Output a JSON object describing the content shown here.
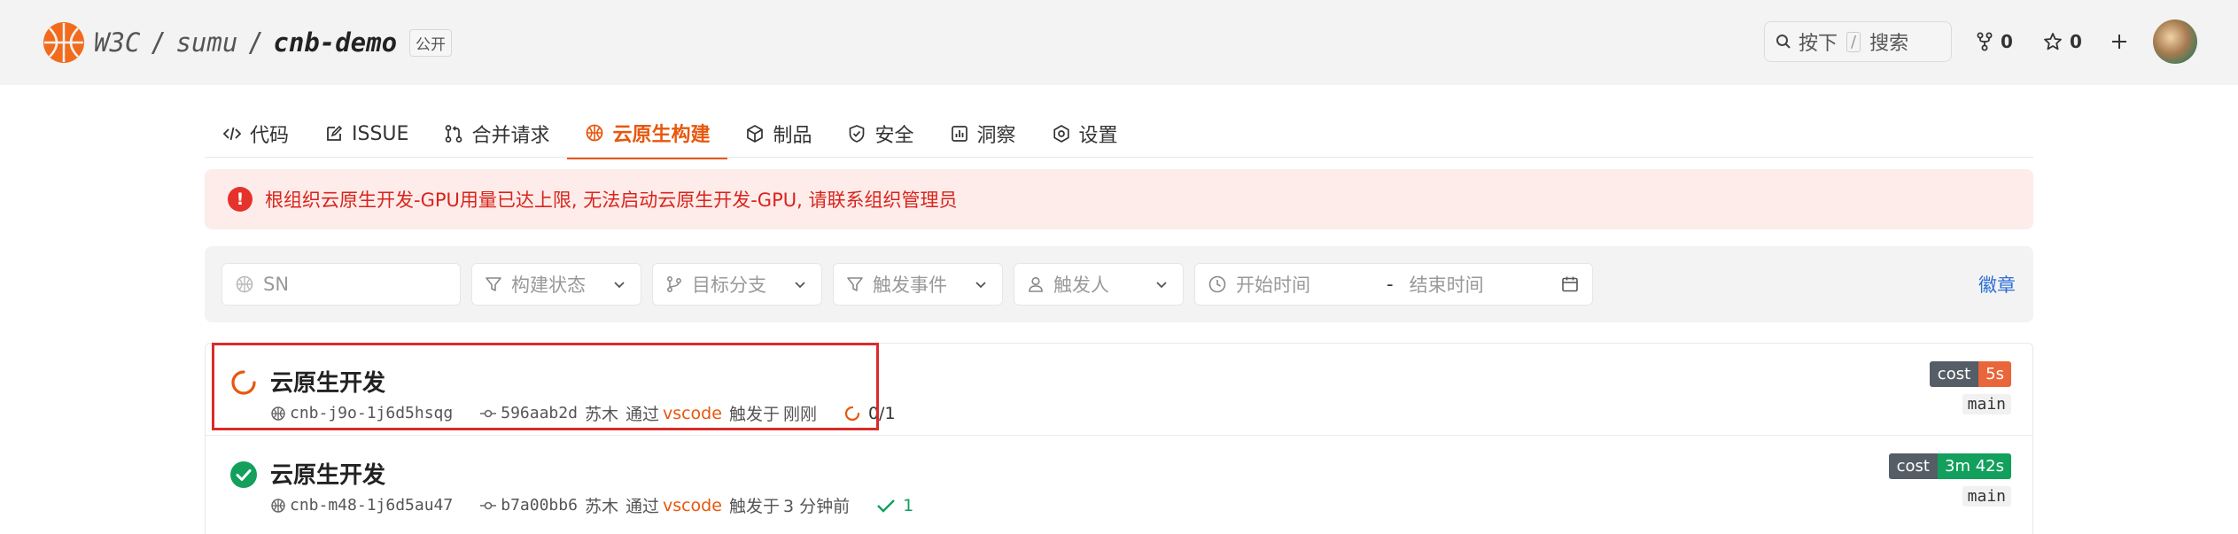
{
  "header": {
    "org": "W3C",
    "group": "sumu",
    "repo": "cnb-demo",
    "visibility": "公开",
    "search": {
      "press": "按下",
      "key": "/",
      "label": "搜索"
    },
    "forks": "0",
    "stars": "0"
  },
  "tabs": [
    {
      "label": "代码",
      "icon": "code-icon"
    },
    {
      "label": "ISSUE",
      "icon": "edit-icon"
    },
    {
      "label": "合并请求",
      "icon": "pull-request-icon"
    },
    {
      "label": "云原生构建",
      "icon": "build-icon",
      "active": true
    },
    {
      "label": "制品",
      "icon": "package-icon"
    },
    {
      "label": "安全",
      "icon": "shield-icon"
    },
    {
      "label": "洞察",
      "icon": "chart-icon"
    },
    {
      "label": "设置",
      "icon": "gear-icon"
    }
  ],
  "alert": {
    "text": "根组织云原生开发-GPU用量已达上限, 无法启动云原生开发-GPU, 请联系组织管理员"
  },
  "filters": {
    "sn_placeholder": "SN",
    "status": "构建状态",
    "branch": "目标分支",
    "event": "触发事件",
    "trigger_user": "触发人",
    "start_time": "开始时间",
    "range_sep": "-",
    "end_time": "结束时间",
    "badge_link": "徽章"
  },
  "builds": [
    {
      "title": "云原生开发",
      "status": "running",
      "sn": "cnb-j9o-1j6d5hsqg",
      "commit": "596aab2d",
      "user": "苏木",
      "via_label": "通过",
      "via": "vscode",
      "trigger_label": "触发于",
      "when": "刚刚",
      "progress": "0/1",
      "cost_label": "cost",
      "cost": "5s",
      "branch": "main"
    },
    {
      "title": "云原生开发",
      "status": "success",
      "sn": "cnb-m48-1j6d5au47",
      "commit": "b7a00bb6",
      "user": "苏木",
      "via_label": "通过",
      "via": "vscode",
      "trigger_label": "触发于",
      "when": "3 分钟前",
      "progress": "1",
      "cost_label": "cost",
      "cost": "3m 42s",
      "branch": "main"
    }
  ],
  "colors": {
    "accent": "#e8570d",
    "success": "#12a05c",
    "danger": "#e5322b",
    "cost_running": "#e8663a"
  }
}
